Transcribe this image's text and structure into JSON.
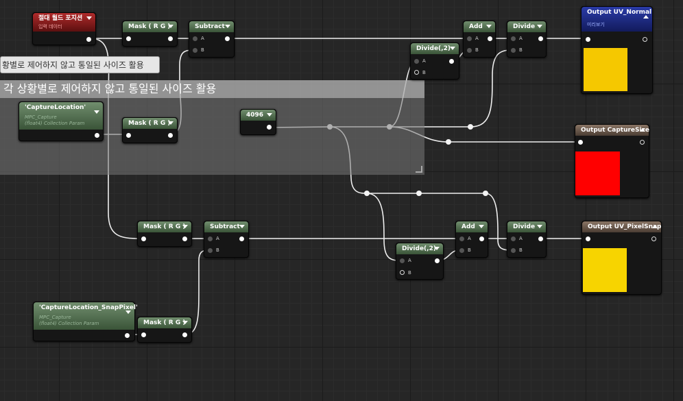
{
  "comment": {
    "title": "각 상황별로 제어하지 않고 통일된 사이즈 활용"
  },
  "bubble": {
    "text": "황별로 제어하지 않고 통일된 사이즈 활용"
  },
  "nodes": {
    "abs_world_pos": {
      "title": "절대 월드 포지션",
      "subtitle": "입력 데이터"
    },
    "mask1": {
      "title": "Mask ( R G )"
    },
    "mask2": {
      "title": "Mask ( R G )"
    },
    "mask3": {
      "title": "Mask ( R G )"
    },
    "mask4": {
      "title": "Mask ( R G )"
    },
    "subtract1": {
      "title": "Subtract",
      "a": "A",
      "b": "B"
    },
    "subtract2": {
      "title": "Subtract",
      "a": "A",
      "b": "B"
    },
    "capture_location": {
      "title": "'CaptureLocation'",
      "sub1": "MPC_Capture",
      "sub2": "(float4) Collection Param"
    },
    "capture_snap": {
      "title": "'CaptureLocation_SnapPixel'",
      "sub1": "MPC_Capture",
      "sub2": "(float4) Collection Param"
    },
    "const4096": {
      "title": "4096"
    },
    "divide_c1": {
      "title": "Divide(,2)",
      "a": "A",
      "b": "B"
    },
    "divide_c2": {
      "title": "Divide(,2)",
      "a": "A",
      "b": "B"
    },
    "add1": {
      "title": "Add",
      "a": "A",
      "b": "B"
    },
    "add2": {
      "title": "Add",
      "a": "A",
      "b": "B"
    },
    "divide1": {
      "title": "Divide",
      "a": "A",
      "b": "B"
    },
    "divide2": {
      "title": "Divide",
      "a": "A",
      "b": "B"
    },
    "out_normal": {
      "title": "Output UV_Normal",
      "subtitle": "미리보기"
    },
    "out_size": {
      "title": "Output CaptureSize"
    },
    "out_snap": {
      "title": "Output UV_PixelSnap"
    }
  },
  "colors": {
    "wire": "#f2f2f2",
    "preview_yellow": "#f5c800",
    "preview_red": "#ff0000",
    "preview_yellow2": "#f7d400"
  }
}
